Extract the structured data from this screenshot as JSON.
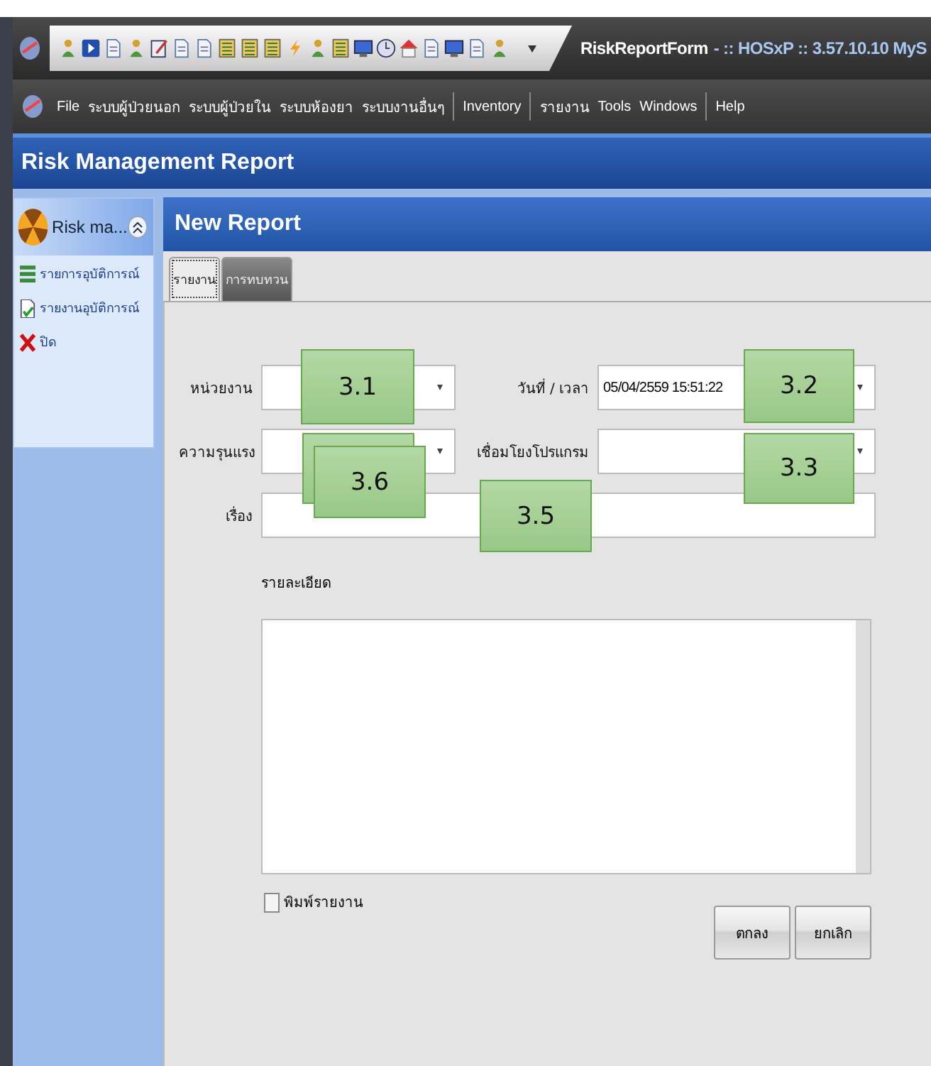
{
  "title_bar": {
    "app_title": "RiskReportForm",
    "app_info": "- :: HOSxP :: 3.57.10.10 MyS"
  },
  "menu_bar": {
    "groups": [
      [
        "File",
        "ระบบผู้ป่วยนอก",
        "ระบบผู้ป่วยใน",
        "ระบบห้องยา",
        "ระบบงานอื่นๆ"
      ],
      [
        "Inventory"
      ],
      [
        "รายงาน",
        "Tools",
        "Windows"
      ],
      [
        "Help"
      ]
    ]
  },
  "header": {
    "title": "Risk Management Report"
  },
  "sidebar": {
    "title": "Risk ma...",
    "expanded": true,
    "items": [
      {
        "label": "รายการอุบัติการณ์",
        "kind": "list"
      },
      {
        "label": "รายงานอุบัติการณ์",
        "kind": "document"
      },
      {
        "label": "ปิด",
        "kind": "close"
      }
    ]
  },
  "content": {
    "title": "New Report",
    "tabs": [
      {
        "label": "รายงาน",
        "selected": true
      },
      {
        "label": "การทบทวน",
        "selected": false
      }
    ],
    "fields": [
      {
        "label": "หน่วยงาน",
        "kind": "dropdown"
      },
      {
        "label": "วันที่ / เวลา",
        "kind": "dropdown",
        "value": "05/04/2559 15:51:22"
      },
      {
        "label": "ความรุนแรง",
        "kind": "dropdown"
      },
      {
        "label": "เชื่อมโยงโปรแกรม",
        "kind": "dropdown"
      },
      {
        "label": "เรื่อง",
        "kind": "text"
      }
    ],
    "details_label": "รายละเอียด",
    "print_checkbox": {
      "label": "พิมพ์รายงาน",
      "checked": false
    },
    "buttons": [
      "ตกลง",
      "ยกเลิก"
    ]
  },
  "callouts": [
    {
      "kind": "label",
      "label": "3.1"
    },
    {
      "kind": "label",
      "label": "3.2"
    },
    {
      "kind": "label",
      "label": "3.3"
    },
    {
      "kind": "label",
      "label": "3.5"
    },
    {
      "kind": "blank"
    },
    {
      "kind": "label",
      "label": "3.6"
    }
  ]
}
